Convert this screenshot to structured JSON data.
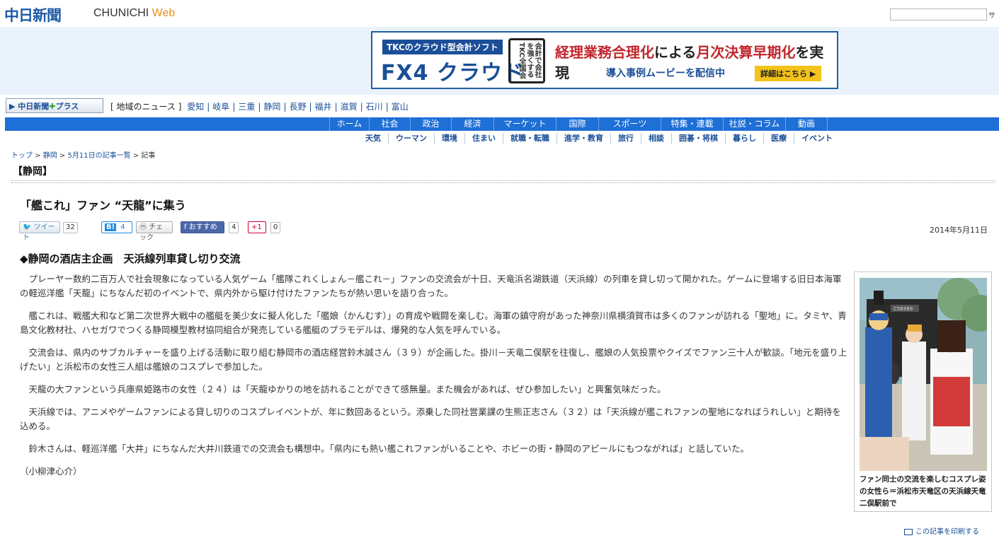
{
  "header": {
    "logo_jp": "中日新聞",
    "logo_en": "CHUNICHI",
    "logo_web": "Web",
    "search_button": "サ"
  },
  "ad": {
    "tag": "TKCのクラウド型会計ソフト",
    "brand": "FX4 クラウド",
    "seal": "会計で会社を強くする TKC全国会",
    "headline_pre": "経理業務合理化",
    "headline_mid": "による",
    "headline_post": "月次決算早期化",
    "headline_end": "を実現",
    "sub": "導入事例ムービーを配信中",
    "button": "詳細はこちら ▶"
  },
  "regionbar": {
    "plus_brand": "中日新聞",
    "plus_suffix": "プラス",
    "prefix": "[ 地域のニュース ]",
    "regions": [
      "愛知",
      "岐阜",
      "三重",
      "静岡",
      "長野",
      "福井",
      "滋賀",
      "石川",
      "富山"
    ]
  },
  "nav": {
    "main": [
      {
        "label": "ホーム",
        "w": 56
      },
      {
        "label": "社会",
        "w": 58
      },
      {
        "label": "政治",
        "w": 58
      },
      {
        "label": "経済",
        "w": 60
      },
      {
        "label": "マーケット",
        "w": 88
      },
      {
        "label": "国際",
        "w": 60
      },
      {
        "label": "スポーツ",
        "w": 88
      },
      {
        "label": "特集・連載",
        "w": 88
      },
      {
        "label": "社説・コラム",
        "w": 88
      },
      {
        "label": "動画",
        "w": 60
      }
    ],
    "sub": [
      "天気",
      "ウーマン",
      "環境",
      "住まい",
      "就職・転職",
      "進学・教育",
      "旅行",
      "相談",
      "囲碁・将棋",
      "暮らし",
      "医療",
      "イベント"
    ]
  },
  "breadcrumb": {
    "items": [
      "トップ",
      "静岡",
      "5月11日の記事一覧"
    ],
    "current": "記事"
  },
  "section_title": "【静岡】",
  "article": {
    "headline": "「艦これ」ファン “天龍”に集う",
    "social": {
      "tweet": "ツイート",
      "tweet_count": "32",
      "hatena_count": "4",
      "mixi": "チェック",
      "facebook": "おすすめ",
      "facebook_count": "4",
      "gplus": "+1",
      "gplus_count": "0"
    },
    "date": "2014年5月11日",
    "subhead": "◆静岡の酒店主企画　天浜線列車貸し切り交流",
    "paragraphs": [
      "プレーヤー数約二百万人で社会現象になっている人気ゲーム「艦隊これくしょん－艦これ－」ファンの交流会が十日、天竜浜名湖鉄道（天浜線）の列車を貸し切って開かれた。ゲームに登場する旧日本海軍の軽巡洋艦「天龍」にちなんだ初のイベントで、県内外から駆け付けたファンたちが熱い思いを語り合った。",
      "艦これは、戦艦大和など第二次世界大戦中の艦艇を美少女に擬人化した「艦娘（かんむす）」の育成や戦闘を楽しむ。海軍の鎮守府があった神奈川県横須賀市は多くのファンが訪れる「聖地」に。タミヤ、青島文化教材社、ハセガワでつくる静岡模型教材協同組合が発売している艦艇のプラモデルは、爆発的な人気を呼んでいる。",
      "交流会は、県内のサブカルチャーを盛り上げる活動に取り組む静岡市の酒店経営鈴木誠さん（３９）が企画した。掛川－天竜二俣駅を往復し、艦娘の人気投票やクイズでファン三十人が歓談。「地元を盛り上げたい」と浜松市の女性三人組は艦娘のコスプレで参加した。",
      "天龍の大ファンという兵庫県姫路市の女性（２４）は「天龍ゆかりの地を訪れることができて感無量。また機会があれば、ぜひ参加したい」と興奮気味だった。",
      "天浜線では、アニメやゲームファンによる貸し切りのコスプレイベントが、年に数回あるという。添乗した同社営業課の生熊正志さん（３２）は「天浜線が艦これファンの聖地になればうれしい」と期待を込める。",
      "鈴木さんは、軽巡洋艦「大井」にちなんだ大井川鉄道での交流会も構想中。「県内にも熱い艦これファンがいることや、ホビーの街・静岡のアピールにもつながれば」と話していた。"
    ],
    "byline": "（小柳津心介）",
    "photo_caption": "ファン同士の交流を楽しむコスプレ姿の女性ら＝浜松市天竜区の天浜線天竜二俣駅前で",
    "locomotive_plate": "C58389"
  },
  "print_link": "この記事を印刷する"
}
